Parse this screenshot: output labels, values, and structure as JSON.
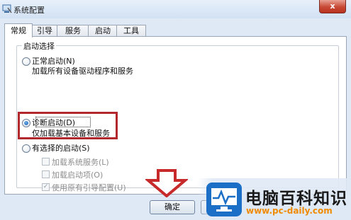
{
  "window": {
    "title": "系统配置",
    "close_glyph": "x"
  },
  "tabs": [
    "常规",
    "引导",
    "服务",
    "启动",
    "工具"
  ],
  "startup_group": {
    "legend": "启动选择",
    "normal": {
      "label": "正常启动(N)",
      "desc": "加载所有设备驱动程序和服务"
    },
    "diagnostic": {
      "label": "诊断启动(D)",
      "desc": "仅加载基本设备和服务"
    },
    "selective": {
      "label": "有选择的启动(S)"
    },
    "selected": "diagnostic",
    "sub_options": [
      {
        "label": "加载系统服务(L)",
        "checked": false
      },
      {
        "label": "加载启动项(O)",
        "checked": false
      },
      {
        "label": "使用原有引导配置(U)",
        "checked": true
      }
    ]
  },
  "buttons": {
    "ok": "确定"
  },
  "colors": {
    "highlight": "#b3282c",
    "arrow": "#c62a2a",
    "url": "#f08a00"
  },
  "watermark": {
    "title": "电脑百科知识",
    "url": "www.pc-daily.com"
  }
}
